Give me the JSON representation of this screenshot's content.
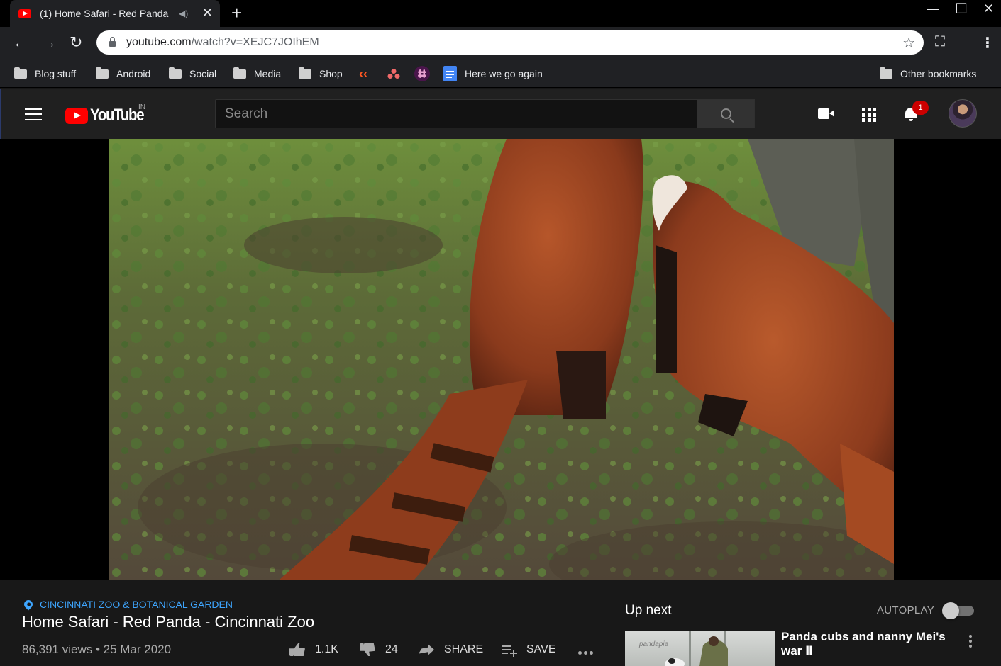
{
  "browser": {
    "tab_title": "(1) Home Safari - Red Panda",
    "url_host": "youtube.com",
    "url_path": "/watch?v=XEJC7JOIhEM",
    "bookmarks": [
      {
        "label": "Blog stuff",
        "icon": "folder-icon"
      },
      {
        "label": "Android",
        "icon": "folder-icon"
      },
      {
        "label": "Social",
        "icon": "folder-icon"
      },
      {
        "label": "Media",
        "icon": "folder-icon"
      },
      {
        "label": "Shop",
        "icon": "folder-icon"
      },
      {
        "label": "Here we go again",
        "icon": "docs-icon"
      }
    ],
    "other_bookmarks": "Other bookmarks"
  },
  "youtube": {
    "logo_text": "YouTube",
    "country": "IN",
    "search_placeholder": "Search",
    "notification_count": "1",
    "accent": "#ff0000"
  },
  "video": {
    "location": "CINCINNATI ZOO & BOTANICAL GARDEN",
    "title": "Home Safari - Red Panda - Cincinnati Zoo",
    "views_date": "86,391 views • 25 Mar 2020",
    "likes": "1.1K",
    "dislikes": "24",
    "share_label": "SHARE",
    "save_label": "SAVE"
  },
  "up_next": {
    "heading": "Up next",
    "autoplay_label": "AUTOPLAY",
    "autoplay_on": false,
    "items": [
      {
        "title": "Panda cubs and nanny Mei's war Ⅱ",
        "thumb_brand": "pandapia"
      }
    ]
  }
}
